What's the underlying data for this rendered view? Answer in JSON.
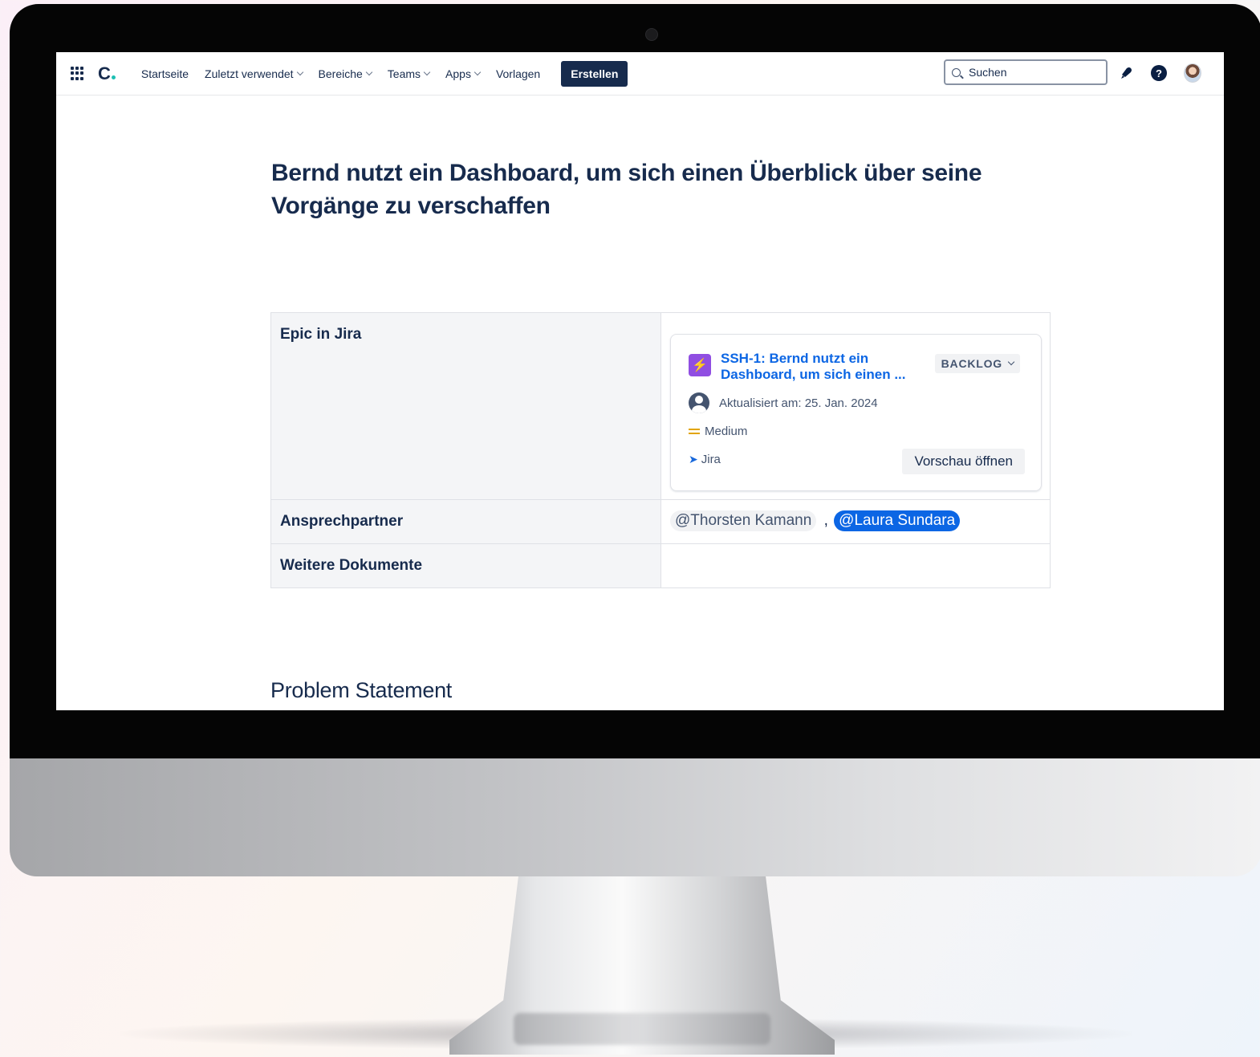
{
  "nav": {
    "items": [
      {
        "label": "Startseite",
        "dropdown": false
      },
      {
        "label": "Zuletzt verwendet",
        "dropdown": true
      },
      {
        "label": "Bereiche",
        "dropdown": true
      },
      {
        "label": "Teams",
        "dropdown": true
      },
      {
        "label": "Apps",
        "dropdown": true
      },
      {
        "label": "Vorlagen",
        "dropdown": false
      }
    ],
    "logo": "C",
    "create_label": "Erstellen",
    "search_placeholder": "Suchen",
    "icons": [
      "app-switcher-icon",
      "notification-bell-icon",
      "help-icon",
      "avatar"
    ]
  },
  "page": {
    "title": "Bernd nutzt ein Dashboard, um sich einen Überblick über seine Vorgänge zu verschaffen",
    "section_heading": "Problem Statement"
  },
  "table": {
    "rows": [
      {
        "label": "Epic in Jira"
      },
      {
        "label": "Ansprechpartner"
      },
      {
        "label": "Weitere Dokumente"
      }
    ]
  },
  "jira_card": {
    "title": "SSH-1: Bernd nutzt ein Dashboard, um sich einen ...",
    "status": "BACKLOG",
    "updated": "Aktualisiert am: 25. Jan. 2024",
    "priority": "Medium",
    "source": "Jira",
    "preview_label": "Vorschau öffnen",
    "colors": {
      "epic": "#904ee2",
      "link": "#0c66e4",
      "priority": "#e2a400"
    }
  },
  "contacts": {
    "separator": ",",
    "mentions": [
      "@Thorsten Kamann",
      "@Laura Sundara"
    ]
  },
  "colors": {
    "navy": "#172b4d",
    "table_head_bg": "#f4f5f7",
    "mention_self": "#0c66e4"
  }
}
